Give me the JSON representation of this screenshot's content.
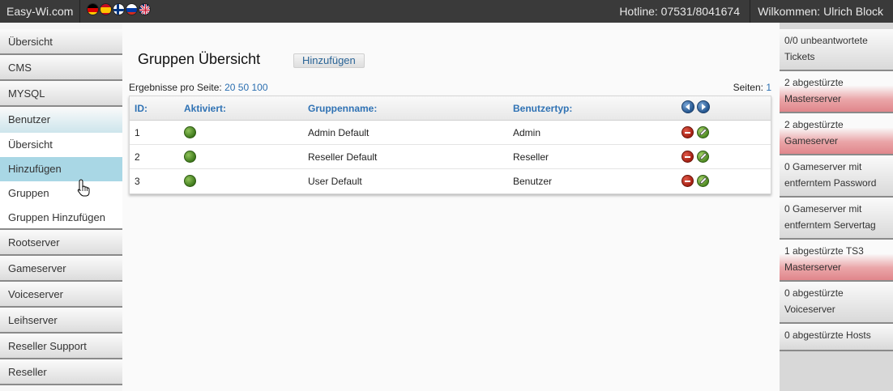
{
  "topbar": {
    "brand": "Easy-Wi.com",
    "flags": [
      "flag-de-icon",
      "flag-es-icon",
      "flag-fi-icon",
      "flag-ru-icon",
      "flag-uk-icon"
    ],
    "hotline": "Hotline: 07531/8041674",
    "welcome": "Wilkommen: Ulrich Block"
  },
  "sidebar": {
    "items": [
      {
        "label": "Übersicht"
      },
      {
        "label": "CMS"
      },
      {
        "label": "MYSQL"
      },
      {
        "label": "Benutzer"
      },
      {
        "label": "Rootserver"
      },
      {
        "label": "Gameserver"
      },
      {
        "label": "Voiceserver"
      },
      {
        "label": "Leihserver"
      },
      {
        "label": "Reseller Support"
      },
      {
        "label": "Reseller"
      }
    ],
    "subitems": [
      {
        "label": "Übersicht"
      },
      {
        "label": "Hinzufügen"
      },
      {
        "label": "Gruppen"
      },
      {
        "label": "Gruppen Hinzufügen"
      }
    ]
  },
  "main": {
    "title": "Gruppen Übersicht",
    "add_label": "Hinzufügen",
    "perpage_label": "Ergebnisse pro Seite:",
    "perpage_options": [
      "20",
      "50",
      "100"
    ],
    "pages_label": "Seiten:",
    "pages": [
      "1"
    ],
    "table": {
      "headers": [
        "ID:",
        "Aktiviert:",
        "Gruppenname:",
        "Benutzertyp:"
      ],
      "rows": [
        {
          "id": "1",
          "name": "Admin Default",
          "type": "Admin"
        },
        {
          "id": "2",
          "name": "Reseller Default",
          "type": "Reseller"
        },
        {
          "id": "3",
          "name": "User Default",
          "type": "Benutzer"
        }
      ]
    }
  },
  "rightbar": {
    "alerts": [
      {
        "text": "0/0 unbeantwortete Tickets"
      },
      {
        "text": "2 abgestürzte Masterserver"
      },
      {
        "text": "2 abgestürzte Gameserver"
      },
      {
        "text": "0 Gameserver mit entferntem Password"
      },
      {
        "text": "0 Gameserver mit entferntem Servertag"
      },
      {
        "text": "1 abgestürzte TS3 Masterserver"
      },
      {
        "text": "0 abgestürzte Voiceserver"
      },
      {
        "text": "0 abgestürzte Hosts"
      }
    ]
  },
  "colors": {
    "topbar": "#3a3a3a",
    "link": "#2a6eb0",
    "hover": "#a9d7e5",
    "alert_red": "#e0868b"
  }
}
